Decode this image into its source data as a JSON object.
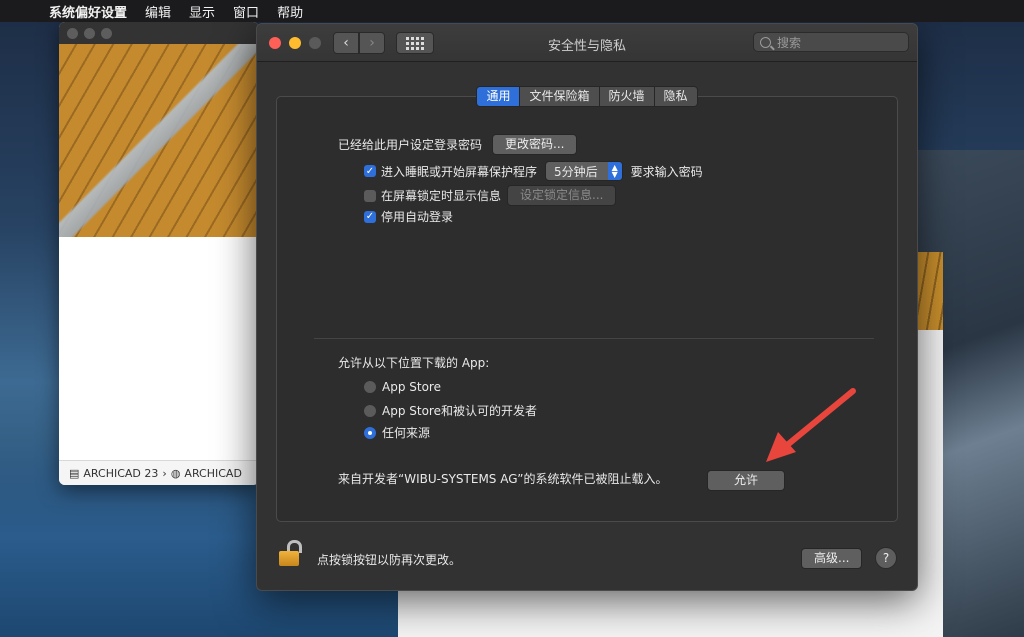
{
  "menubar": {
    "app_name": "系统偏好设置",
    "items": [
      "编辑",
      "显示",
      "窗口",
      "帮助"
    ]
  },
  "background_window": {
    "path": [
      "ARCHICAD 23",
      "ARCHICAD"
    ]
  },
  "window": {
    "title": "安全性与隐私",
    "search_placeholder": "搜索",
    "tabs": [
      "通用",
      "文件保险箱",
      "防火墙",
      "隐私"
    ],
    "active_tab": "通用"
  },
  "general": {
    "password_set_label": "已经给此用户设定登录密码",
    "change_password_button": "更改密码...",
    "require_password": {
      "checked": true,
      "label": "进入睡眠或开始屏幕保护程序",
      "delay_value": "5分钟后",
      "suffix": "要求输入密码"
    },
    "show_message": {
      "checked": false,
      "label": "在屏幕锁定时显示信息",
      "button": "设定锁定信息..."
    },
    "disable_autologin": {
      "checked": true,
      "label": "停用自动登录"
    }
  },
  "downloads": {
    "heading": "允许从以下位置下载的 App:",
    "options": [
      {
        "label": "App Store",
        "selected": false
      },
      {
        "label": "App Store和被认可的开发者",
        "selected": false
      },
      {
        "label": "任何来源",
        "selected": true
      }
    ],
    "blocked_message": "来自开发者“WIBU-SYSTEMS AG”的系统软件已被阻止载入。",
    "allow_button": "允许"
  },
  "footer": {
    "lock_text": "点按锁按钮以防再次更改。",
    "advanced_button": "高级...",
    "help_label": "?"
  },
  "colors": {
    "accent": "#2e6fd9",
    "arrow": "#e8463d"
  }
}
